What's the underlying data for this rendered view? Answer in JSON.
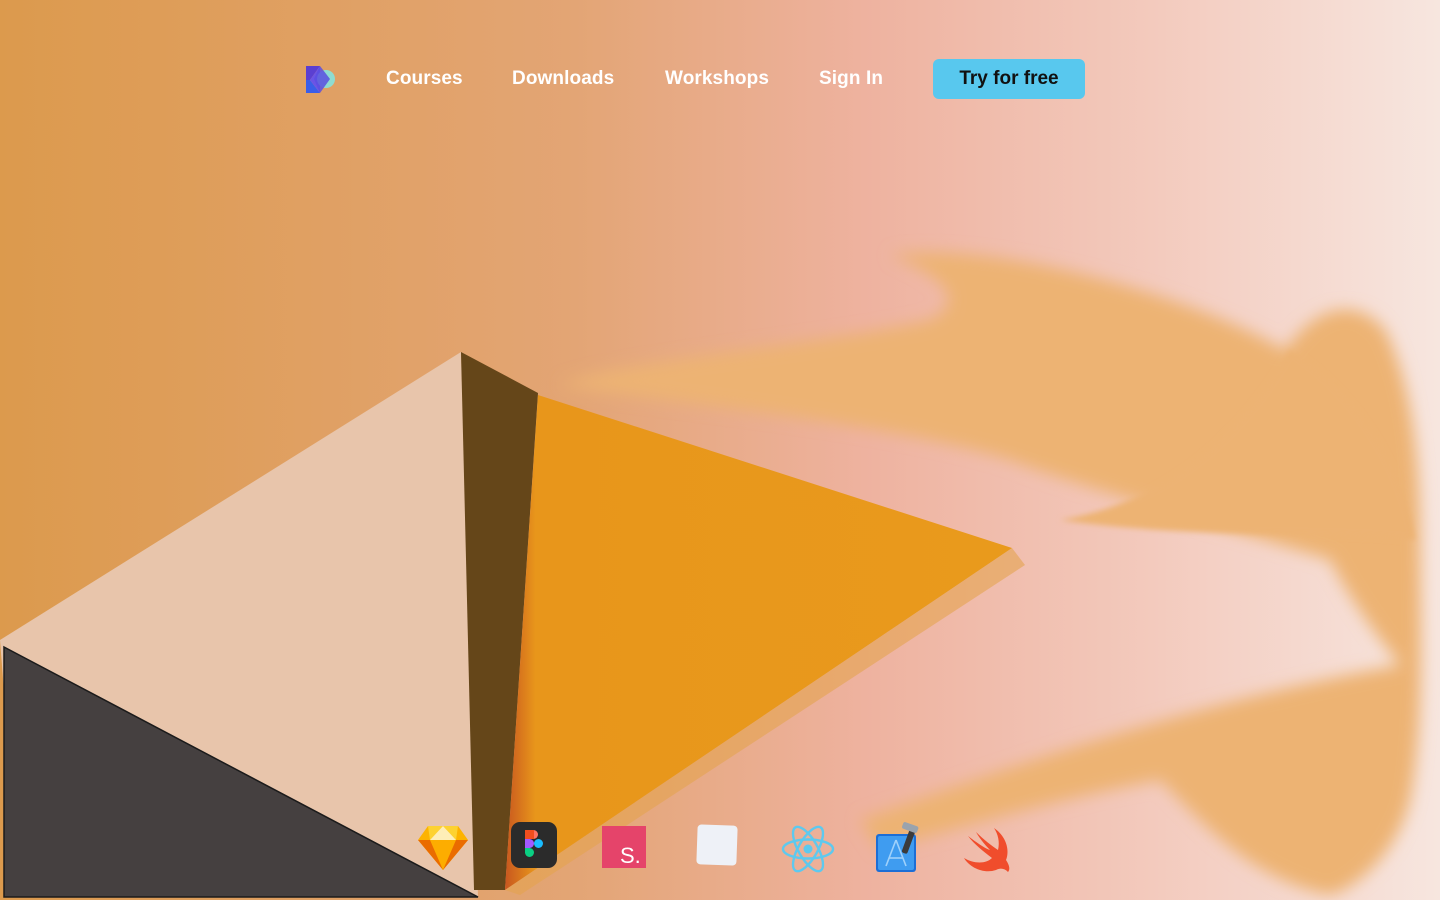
{
  "nav": {
    "logo_icon": "brand-logo-icon",
    "links": [
      {
        "label": "Courses"
      },
      {
        "label": "Downloads"
      },
      {
        "label": "Workshops"
      },
      {
        "label": "Sign In"
      }
    ],
    "cta_label": "Try for free"
  },
  "tools": [
    {
      "icon": "sketch-icon"
    },
    {
      "icon": "figma-icon"
    },
    {
      "icon": "studio-s-icon",
      "letter": "S."
    },
    {
      "icon": "blank-app-icon"
    },
    {
      "icon": "react-icon"
    },
    {
      "icon": "xcode-icon"
    },
    {
      "icon": "swift-icon"
    }
  ],
  "colors": {
    "cta_background": "#58c8ee",
    "hero_orange": "#e99a1c",
    "hero_brown": "#654619",
    "hero_beige": "#e8c5ab",
    "hero_dark": "#454040"
  }
}
